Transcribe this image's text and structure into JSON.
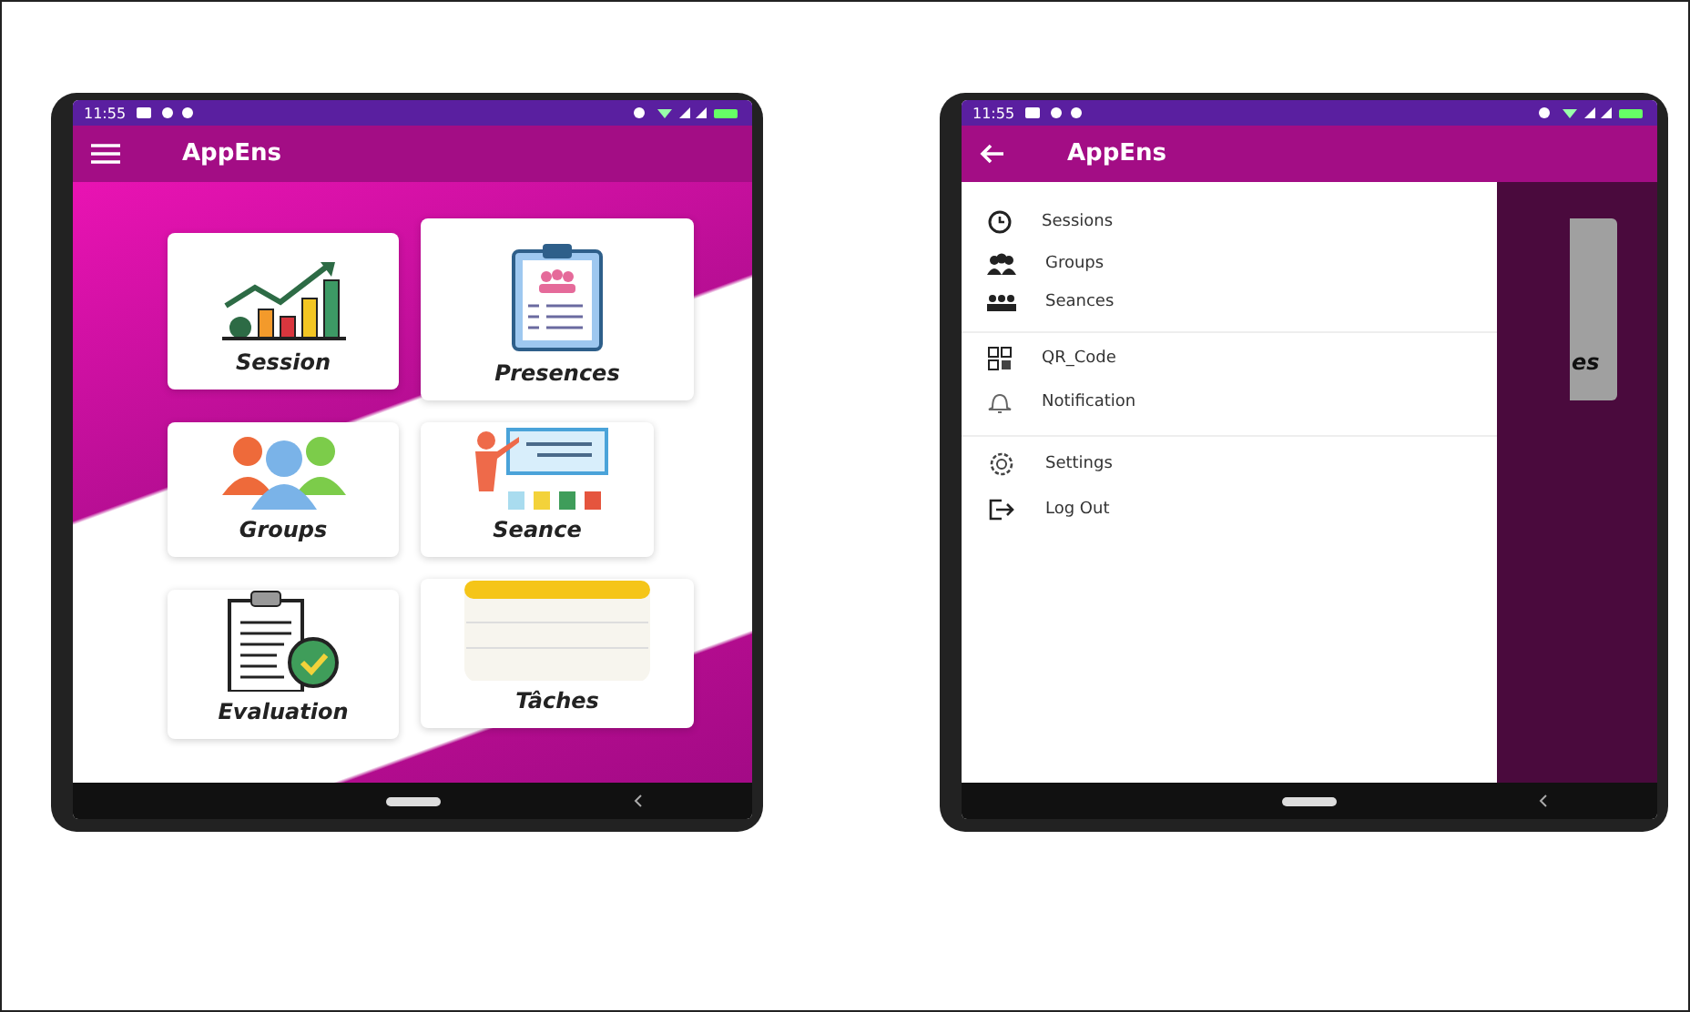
{
  "phones": [
    {
      "kind": "home",
      "status_time": "11:55",
      "app_title": "AppEns",
      "tiles": [
        {
          "label": "Session"
        },
        {
          "label": "Presences"
        },
        {
          "label": "Groups"
        },
        {
          "label": "Seance"
        },
        {
          "label": "Evaluation"
        },
        {
          "label": "Tâches"
        }
      ]
    },
    {
      "kind": "drawer",
      "status_time": "11:55",
      "app_title": "AppEns",
      "behind_text": "es",
      "menu_sections": [
        {
          "items": [
            {
              "label": "Sessions"
            },
            {
              "label": "Groups"
            },
            {
              "label": "Seances"
            }
          ]
        },
        {
          "items": [
            {
              "label": "QR_Code"
            },
            {
              "label": "Notification"
            }
          ]
        },
        {
          "items": [
            {
              "label": "Settings"
            },
            {
              "label": "Log Out"
            }
          ]
        }
      ]
    }
  ]
}
